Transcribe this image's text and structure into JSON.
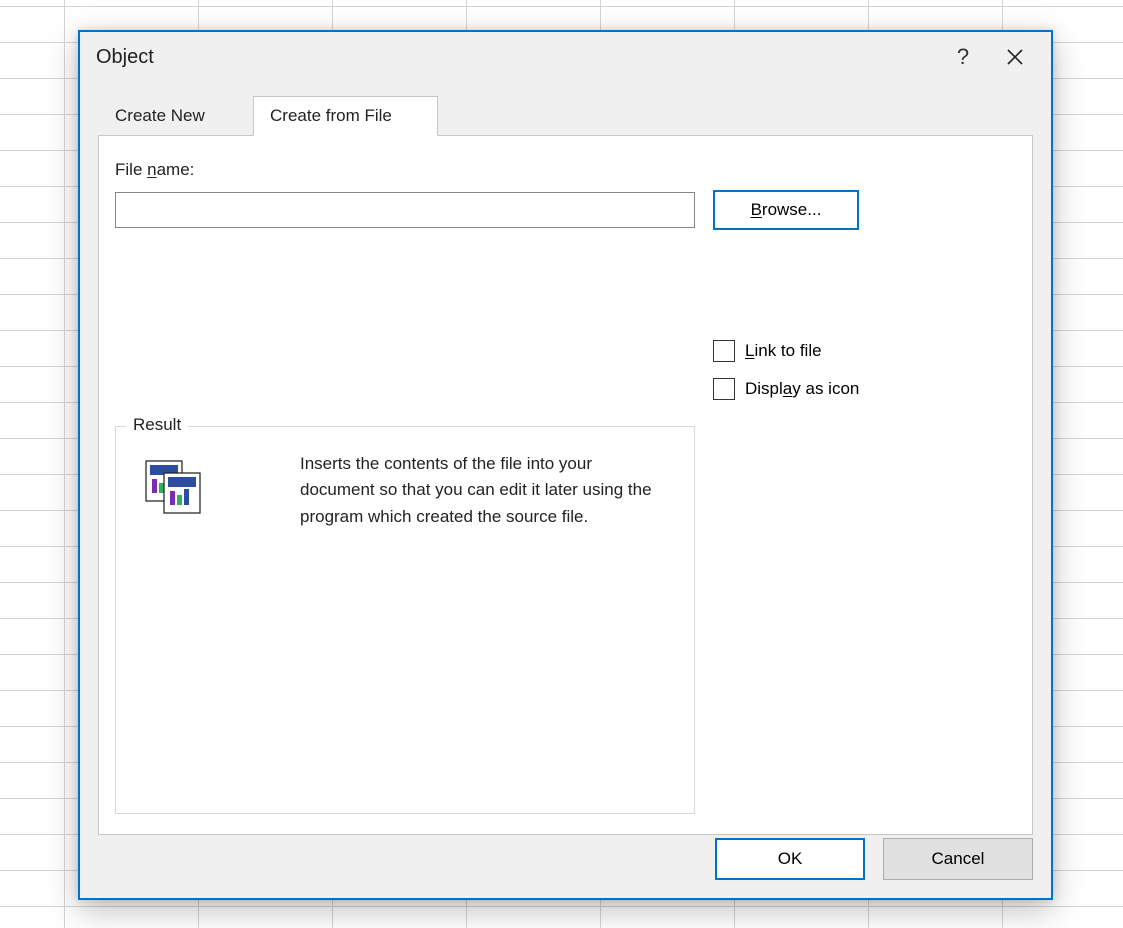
{
  "dialog": {
    "title": "Object",
    "help_label": "?",
    "close_label": "Close"
  },
  "tabs": {
    "create_new": "Create New",
    "create_from_file": "Create from File"
  },
  "form": {
    "file_name_label": "File name:",
    "file_name_value": "",
    "browse_label": "Browse...",
    "link_to_file_label": "Link to file",
    "display_as_icon_label": "Display as icon"
  },
  "result": {
    "legend": "Result",
    "description": "Inserts the contents of the file into your document so that you can edit it later using the program which created the source file."
  },
  "buttons": {
    "ok": "OK",
    "cancel": "Cancel"
  }
}
